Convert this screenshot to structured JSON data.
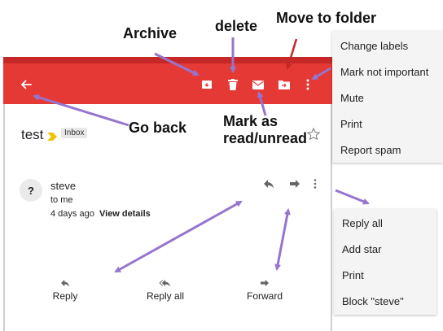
{
  "annotations": {
    "archive": "Archive",
    "delete": "delete",
    "move_to_folder": "Move to folder",
    "go_back": "Go back",
    "mark_read": "Mark as read/unread"
  },
  "email": {
    "subject": "test",
    "label": "Inbox",
    "sender": "steve",
    "recipient": "to me",
    "date": "4 days ago",
    "details_link": "View details",
    "avatar_letter": "?"
  },
  "toolbar_menu": {
    "items": [
      "Change labels",
      "Mark not important",
      "Mute",
      "Print",
      "Report spam"
    ]
  },
  "message_menu": {
    "items": [
      "Reply all",
      "Add star",
      "Print",
      "Block \"steve\""
    ]
  },
  "bottom_actions": {
    "reply": "Reply",
    "reply_all": "Reply all",
    "forward": "Forward"
  },
  "colors": {
    "app_bar": "#e53935",
    "annotation_arrow": "#9575cd",
    "highlight_arrow": "#c62828"
  },
  "icons": {
    "back": "arrow-left-icon",
    "archive": "archive-icon",
    "delete": "trash-icon",
    "mark_read": "envelope-icon",
    "move": "folder-move-icon",
    "more": "more-vertical-icon",
    "important": "important-marker-icon",
    "star": "star-outline-icon",
    "reply": "reply-icon",
    "reply_all": "reply-all-icon",
    "forward": "forward-icon"
  }
}
